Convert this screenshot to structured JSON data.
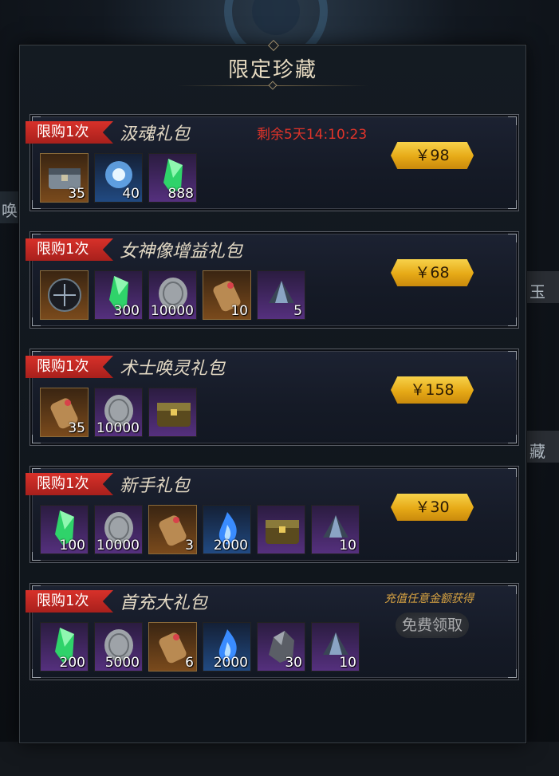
{
  "panel": {
    "title": "限定珍藏"
  },
  "background_text": {
    "left": "唤",
    "right_top": "玉",
    "right_mid": "藏"
  },
  "packs": [
    {
      "tag": "限购1次",
      "name": "汲魂礼包",
      "timer": "剩余5天14:10:23",
      "price": "￥98",
      "items": [
        {
          "icon": "chest-icon",
          "count": "35"
        },
        {
          "icon": "blue-orb-icon",
          "count": "40"
        },
        {
          "icon": "green-crystal-icon",
          "count": "888"
        }
      ]
    },
    {
      "tag": "限购1次",
      "name": "女神像增益礼包",
      "price": "￥68",
      "items": [
        {
          "icon": "dark-rune-icon",
          "count": ""
        },
        {
          "icon": "green-crystal-icon",
          "count": "300"
        },
        {
          "icon": "silver-coin-icon",
          "count": "10000"
        },
        {
          "icon": "scroll-icon",
          "count": "10"
        },
        {
          "icon": "dark-shard-icon",
          "count": "5"
        }
      ]
    },
    {
      "tag": "限购1次",
      "name": "术士唤灵礼包",
      "price": "￥158",
      "items": [
        {
          "icon": "scroll-icon",
          "count": "35"
        },
        {
          "icon": "silver-coin-icon",
          "count": "10000"
        },
        {
          "icon": "treasure-chest-icon",
          "count": ""
        }
      ]
    },
    {
      "tag": "限购1次",
      "name": "新手礼包",
      "price": "￥30",
      "items": [
        {
          "icon": "green-crystal-icon",
          "count": "100"
        },
        {
          "icon": "silver-coin-icon",
          "count": "10000"
        },
        {
          "icon": "scroll-icon",
          "count": "3"
        },
        {
          "icon": "blue-flame-icon",
          "count": "2000"
        },
        {
          "icon": "treasure-chest-icon",
          "count": ""
        },
        {
          "icon": "dark-shard-icon",
          "count": "10"
        }
      ]
    },
    {
      "tag": "限购1次",
      "name": "首充大礼包",
      "note": "充值任意金额获得",
      "button": "免费领取",
      "items": [
        {
          "icon": "green-crystal-icon",
          "count": "200"
        },
        {
          "icon": "silver-coin-icon",
          "count": "5000"
        },
        {
          "icon": "scroll-icon",
          "count": "6"
        },
        {
          "icon": "blue-flame-icon",
          "count": "2000"
        },
        {
          "icon": "ore-icon",
          "count": "30"
        },
        {
          "icon": "dark-shard-icon",
          "count": "10"
        }
      ]
    }
  ]
}
